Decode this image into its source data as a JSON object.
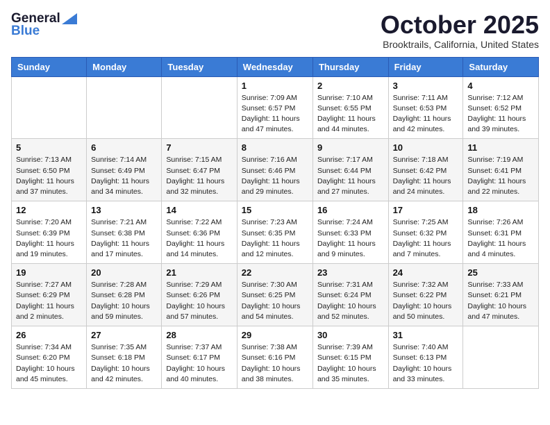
{
  "logo": {
    "line1": "General",
    "line2": "Blue"
  },
  "title": "October 2025",
  "location": "Brooktrails, California, United States",
  "weekdays": [
    "Sunday",
    "Monday",
    "Tuesday",
    "Wednesday",
    "Thursday",
    "Friday",
    "Saturday"
  ],
  "weeks": [
    [
      {
        "day": "",
        "info": ""
      },
      {
        "day": "",
        "info": ""
      },
      {
        "day": "",
        "info": ""
      },
      {
        "day": "1",
        "info": "Sunrise: 7:09 AM\nSunset: 6:57 PM\nDaylight: 11 hours and 47 minutes."
      },
      {
        "day": "2",
        "info": "Sunrise: 7:10 AM\nSunset: 6:55 PM\nDaylight: 11 hours and 44 minutes."
      },
      {
        "day": "3",
        "info": "Sunrise: 7:11 AM\nSunset: 6:53 PM\nDaylight: 11 hours and 42 minutes."
      },
      {
        "day": "4",
        "info": "Sunrise: 7:12 AM\nSunset: 6:52 PM\nDaylight: 11 hours and 39 minutes."
      }
    ],
    [
      {
        "day": "5",
        "info": "Sunrise: 7:13 AM\nSunset: 6:50 PM\nDaylight: 11 hours and 37 minutes."
      },
      {
        "day": "6",
        "info": "Sunrise: 7:14 AM\nSunset: 6:49 PM\nDaylight: 11 hours and 34 minutes."
      },
      {
        "day": "7",
        "info": "Sunrise: 7:15 AM\nSunset: 6:47 PM\nDaylight: 11 hours and 32 minutes."
      },
      {
        "day": "8",
        "info": "Sunrise: 7:16 AM\nSunset: 6:46 PM\nDaylight: 11 hours and 29 minutes."
      },
      {
        "day": "9",
        "info": "Sunrise: 7:17 AM\nSunset: 6:44 PM\nDaylight: 11 hours and 27 minutes."
      },
      {
        "day": "10",
        "info": "Sunrise: 7:18 AM\nSunset: 6:42 PM\nDaylight: 11 hours and 24 minutes."
      },
      {
        "day": "11",
        "info": "Sunrise: 7:19 AM\nSunset: 6:41 PM\nDaylight: 11 hours and 22 minutes."
      }
    ],
    [
      {
        "day": "12",
        "info": "Sunrise: 7:20 AM\nSunset: 6:39 PM\nDaylight: 11 hours and 19 minutes."
      },
      {
        "day": "13",
        "info": "Sunrise: 7:21 AM\nSunset: 6:38 PM\nDaylight: 11 hours and 17 minutes."
      },
      {
        "day": "14",
        "info": "Sunrise: 7:22 AM\nSunset: 6:36 PM\nDaylight: 11 hours and 14 minutes."
      },
      {
        "day": "15",
        "info": "Sunrise: 7:23 AM\nSunset: 6:35 PM\nDaylight: 11 hours and 12 minutes."
      },
      {
        "day": "16",
        "info": "Sunrise: 7:24 AM\nSunset: 6:33 PM\nDaylight: 11 hours and 9 minutes."
      },
      {
        "day": "17",
        "info": "Sunrise: 7:25 AM\nSunset: 6:32 PM\nDaylight: 11 hours and 7 minutes."
      },
      {
        "day": "18",
        "info": "Sunrise: 7:26 AM\nSunset: 6:31 PM\nDaylight: 11 hours and 4 minutes."
      }
    ],
    [
      {
        "day": "19",
        "info": "Sunrise: 7:27 AM\nSunset: 6:29 PM\nDaylight: 11 hours and 2 minutes."
      },
      {
        "day": "20",
        "info": "Sunrise: 7:28 AM\nSunset: 6:28 PM\nDaylight: 10 hours and 59 minutes."
      },
      {
        "day": "21",
        "info": "Sunrise: 7:29 AM\nSunset: 6:26 PM\nDaylight: 10 hours and 57 minutes."
      },
      {
        "day": "22",
        "info": "Sunrise: 7:30 AM\nSunset: 6:25 PM\nDaylight: 10 hours and 54 minutes."
      },
      {
        "day": "23",
        "info": "Sunrise: 7:31 AM\nSunset: 6:24 PM\nDaylight: 10 hours and 52 minutes."
      },
      {
        "day": "24",
        "info": "Sunrise: 7:32 AM\nSunset: 6:22 PM\nDaylight: 10 hours and 50 minutes."
      },
      {
        "day": "25",
        "info": "Sunrise: 7:33 AM\nSunset: 6:21 PM\nDaylight: 10 hours and 47 minutes."
      }
    ],
    [
      {
        "day": "26",
        "info": "Sunrise: 7:34 AM\nSunset: 6:20 PM\nDaylight: 10 hours and 45 minutes."
      },
      {
        "day": "27",
        "info": "Sunrise: 7:35 AM\nSunset: 6:18 PM\nDaylight: 10 hours and 42 minutes."
      },
      {
        "day": "28",
        "info": "Sunrise: 7:37 AM\nSunset: 6:17 PM\nDaylight: 10 hours and 40 minutes."
      },
      {
        "day": "29",
        "info": "Sunrise: 7:38 AM\nSunset: 6:16 PM\nDaylight: 10 hours and 38 minutes."
      },
      {
        "day": "30",
        "info": "Sunrise: 7:39 AM\nSunset: 6:15 PM\nDaylight: 10 hours and 35 minutes."
      },
      {
        "day": "31",
        "info": "Sunrise: 7:40 AM\nSunset: 6:13 PM\nDaylight: 10 hours and 33 minutes."
      },
      {
        "day": "",
        "info": ""
      }
    ]
  ]
}
